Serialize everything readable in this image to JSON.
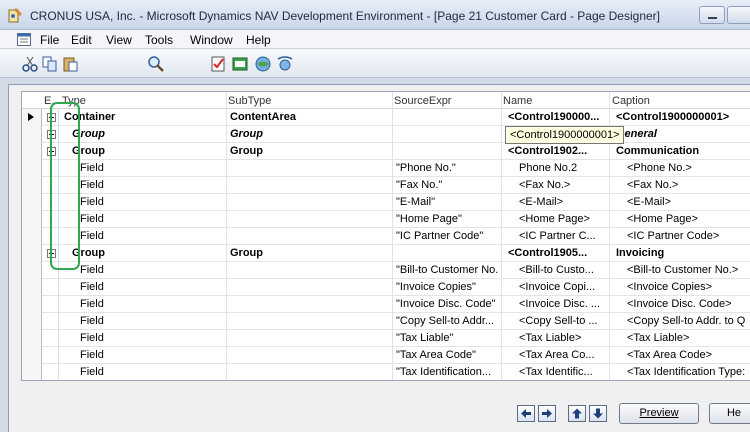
{
  "window": {
    "title": "CRONUS USA, Inc. - Microsoft Dynamics NAV Development Environment - [Page 21 Customer Card - Page Designer]"
  },
  "menu": [
    "File",
    "Edit",
    "View",
    "Tools",
    "Window",
    "Help"
  ],
  "toolbar_icons": [
    "cut-icon",
    "copy-icon",
    "paste-icon",
    "find-icon",
    "properties-icon",
    "designer-icon",
    "objects-icon",
    "debug-icon"
  ],
  "grid": {
    "headers": {
      "e": "E..",
      "type": "Type",
      "subtype": "SubType",
      "source": "SourceExpr",
      "name": "Name",
      "caption": "Caption"
    },
    "rows": [
      {
        "type": "Container",
        "subtype": "ContentArea",
        "source": "",
        "name": "<Control190000...",
        "caption": "<Control1900000001>",
        "style": "bold",
        "expander": "minus",
        "indent": 0,
        "current": true
      },
      {
        "type": "Group",
        "subtype": "Group",
        "source": "",
        "name": "",
        "caption": "General",
        "style": "bolditalic",
        "expander": "plus",
        "indent": 1
      },
      {
        "type": "Group",
        "subtype": "Group",
        "source": "",
        "name": "<Control1902...",
        "caption": "Communication",
        "style": "bold",
        "expander": "minus",
        "indent": 1
      },
      {
        "type": "Field",
        "subtype": "",
        "source": "\"Phone No.\"",
        "name": "Phone No.2",
        "caption": "<Phone No.>",
        "style": "",
        "indent": 2
      },
      {
        "type": "Field",
        "subtype": "",
        "source": "\"Fax No.\"",
        "name": "<Fax No.>",
        "caption": "<Fax No.>",
        "style": "",
        "indent": 2
      },
      {
        "type": "Field",
        "subtype": "",
        "source": "\"E-Mail\"",
        "name": "<E-Mail>",
        "caption": "<E-Mail>",
        "style": "",
        "indent": 2
      },
      {
        "type": "Field",
        "subtype": "",
        "source": "\"Home Page\"",
        "name": "<Home Page>",
        "caption": "<Home Page>",
        "style": "",
        "indent": 2
      },
      {
        "type": "Field",
        "subtype": "",
        "source": "\"IC Partner Code\"",
        "name": "<IC Partner C...",
        "caption": "<IC Partner Code>",
        "style": "",
        "indent": 2
      },
      {
        "type": "Group",
        "subtype": "Group",
        "source": "",
        "name": "<Control1905...",
        "caption": "Invoicing",
        "style": "bold",
        "expander": "minus",
        "indent": 1
      },
      {
        "type": "Field",
        "subtype": "",
        "source": "\"Bill-to Customer No.\"",
        "name": "<Bill-to Custo...",
        "caption": "<Bill-to Customer No.>",
        "style": "",
        "indent": 2
      },
      {
        "type": "Field",
        "subtype": "",
        "source": "\"Invoice Copies\"",
        "name": "<Invoice Copi...",
        "caption": "<Invoice Copies>",
        "style": "",
        "indent": 2
      },
      {
        "type": "Field",
        "subtype": "",
        "source": "\"Invoice Disc. Code\"",
        "name": "<Invoice Disc. ...",
        "caption": "<Invoice Disc. Code>",
        "style": "",
        "indent": 2
      },
      {
        "type": "Field",
        "subtype": "",
        "source": "\"Copy Sell-to Addr...",
        "name": "<Copy Sell-to ...",
        "caption": "<Copy Sell-to Addr. to Q",
        "style": "",
        "indent": 2
      },
      {
        "type": "Field",
        "subtype": "",
        "source": "\"Tax Liable\"",
        "name": "<Tax Liable>",
        "caption": "<Tax Liable>",
        "style": "",
        "indent": 2
      },
      {
        "type": "Field",
        "subtype": "",
        "source": "\"Tax Area Code\"",
        "name": "<Tax Area Co...",
        "caption": "<Tax Area Code>",
        "style": "",
        "indent": 2
      },
      {
        "type": "Field",
        "subtype": "",
        "source": "\"Tax Identification...",
        "name": "<Tax Identific...",
        "caption": "<Tax Identification Type:",
        "style": "",
        "indent": 2
      }
    ],
    "tooltip": "<Control1900000001>"
  },
  "buttons": {
    "preview": "Preview",
    "help": "He"
  },
  "colors": {
    "annotation": "#2fa84f",
    "tooltip_bg": "#ffffe1"
  }
}
